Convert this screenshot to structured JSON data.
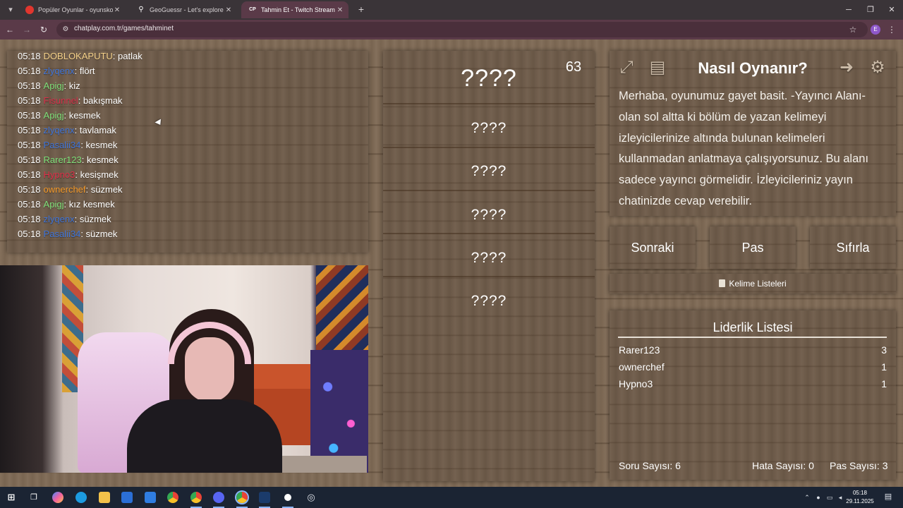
{
  "browser": {
    "tabs": [
      {
        "label": "Popüler Oyunlar - oyunskor.com",
        "favicon_color": "#e2362e",
        "active": false
      },
      {
        "label": "GeoGuessr - Let's explore the world!",
        "favicon_color": "#ffffff",
        "active": false
      },
      {
        "label": "Tahmin Et - Twitch Stream Games",
        "favicon_text": "CP",
        "favicon_color": "#7b4bd8",
        "active": true
      }
    ],
    "url": "chatplay.com.tr/games/tahminet",
    "profile_initial": "E"
  },
  "chat": {
    "messages": [
      {
        "time": "05:18",
        "user": "DOBLOKAPUTU",
        "color": "#f6d28a",
        "text": "patlak"
      },
      {
        "time": "05:18",
        "user": "zlyqenx",
        "color": "#3f74d8",
        "text": "flört"
      },
      {
        "time": "05:18",
        "user": "Apigj",
        "color": "#7fe07a",
        "text": "kiz"
      },
      {
        "time": "05:18",
        "user": "Fisunnel",
        "color": "#d8304a",
        "text": "bakışmak"
      },
      {
        "time": "05:18",
        "user": "Apigj",
        "color": "#7fe07a",
        "text": "kesmek"
      },
      {
        "time": "05:18",
        "user": "zlyqenx",
        "color": "#3f74d8",
        "text": "tavlamak"
      },
      {
        "time": "05:18",
        "user": "Pasalii34",
        "color": "#3f74d8",
        "text": "kesmek"
      },
      {
        "time": "05:18",
        "user": "Rarer123",
        "color": "#7fe07a",
        "text": "kesmek"
      },
      {
        "time": "05:18",
        "user": "Hypno3",
        "color": "#e0304a",
        "text": "kesişmek"
      },
      {
        "time": "05:18",
        "user": "ownerchef",
        "color": "#f59a2a",
        "text": "süzmek"
      },
      {
        "time": "05:18",
        "user": "Apigj",
        "color": "#7fe07a",
        "text": "kız kesmek"
      },
      {
        "time": "05:18",
        "user": "zlyqenx",
        "color": "#3f74d8",
        "text": "süzmek"
      },
      {
        "time": "05:18",
        "user": "Pasalii34",
        "color": "#3f74d8",
        "text": "süzmek"
      }
    ]
  },
  "game": {
    "timer": "63",
    "main_word": "????",
    "forbidden_words": [
      "????",
      "????",
      "????",
      "????",
      "????"
    ]
  },
  "info": {
    "title": "Nasıl Oynanır?",
    "text": "Merhaba, oyunumuz gayet basit. -Yayıncı Alanı- olan sol altta ki bölüm de yazan kelimeyi izleyicilerinize altında bulunan kelimeleri kullanmadan anlatmaya çalışıyorsunuz. Bu alanı sadece yayıncı görmelidir. İzleyicileriniz yayın chatinizde cevap verebilir."
  },
  "buttons": {
    "next": "Sonraki",
    "pass": "Pas",
    "reset": "Sıfırla",
    "word_lists": "Kelime Listeleri"
  },
  "leaderboard": {
    "title": "Liderlik Listesi",
    "rows": [
      {
        "name": "Rarer123",
        "score": "3"
      },
      {
        "name": "ownerchef",
        "score": "1"
      },
      {
        "name": "Hypno3",
        "score": "1"
      }
    ],
    "questions_label": "Soru Sayısı: 6",
    "errors_label": "Hata Sayısı: 0",
    "passes_label": "Pas Sayısı: 3"
  },
  "taskbar": {
    "time": "05:18",
    "date": "29.11.2025"
  }
}
